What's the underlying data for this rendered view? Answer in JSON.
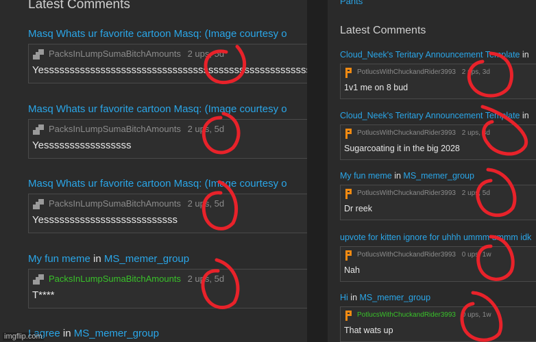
{
  "left": {
    "section_title": "Latest Comments",
    "entries": [
      {
        "post": "Masq Whats ur favorite cartoon Masq: (Image courtesy o",
        "in_word": "",
        "group": "",
        "user": "PacksInLumpSumaBitchAmounts",
        "user_green": false,
        "stats": "2 ups, 5d",
        "text": "Yessssssssssssssssssssssssssssssssssssssssssssssssssss"
      },
      {
        "post": "Masq Whats ur favorite cartoon Masq: (Image courtesy o",
        "in_word": "",
        "group": "",
        "user": "PacksInLumpSumaBitchAmounts",
        "user_green": false,
        "stats": "2 ups, 5d",
        "text": "Yesssssssssssssssss"
      },
      {
        "post": "Masq Whats ur favorite cartoon Masq: (Image courtesy o",
        "in_word": "",
        "group": "",
        "user": "PacksInLumpSumaBitchAmounts",
        "user_green": false,
        "stats": "2 ups, 5d",
        "text": "Yessssssssssssssssssssssssss"
      },
      {
        "post": "My fun meme",
        "in_word": "in",
        "group": "MS_memer_group",
        "user": "PacksInLumpSumaBitchAmounts",
        "user_green": true,
        "stats": "2 ups, 5d",
        "text": "T****"
      },
      {
        "post": "I agree",
        "in_word": "in",
        "group": "MS_memer_group"
      }
    ]
  },
  "right": {
    "top_link": "Pants",
    "section_title": "Latest Comments",
    "entries": [
      {
        "post": "Cloud_Neek's Teritary Announcement Template",
        "in_word": "in",
        "group": "",
        "user": "PotlucsWithChuckandRider3993",
        "user_green": false,
        "stats": "2 ups, 3d",
        "text": "1v1 me on 8 bud"
      },
      {
        "post": "Cloud_Neek's Teritary Announcement Template",
        "in_word": "in",
        "group": "",
        "user": "PotlucsWithChuckandRider3993",
        "user_green": false,
        "stats": "2 ups, 3d",
        "text": "Sugarcoating it in the big 2028"
      },
      {
        "post": "My fun meme",
        "in_word": "in",
        "group": "MS_memer_group",
        "user": "PotlucsWithChuckandRider3993",
        "user_green": false,
        "stats": "2 ups, 5d",
        "text": "Dr reek"
      },
      {
        "post": "upvote for kitten ignore for uhhh ummm ummm idk",
        "in_word": "",
        "group": "",
        "user": "PotlucsWithChuckandRider3993",
        "user_green": false,
        "stats": "0 ups, 1w",
        "text": "Nah"
      },
      {
        "post": "Hi",
        "in_word": "in",
        "group": "MS_memer_group",
        "user": "PotlucsWithChuckandRider3993",
        "user_green": true,
        "stats": "0 ups, 1w",
        "text": "That wats up"
      }
    ]
  },
  "icons": {
    "left_avatar": "imgflip-user-icon",
    "right_avatar": "imgflip-p-user-icon"
  },
  "colors": {
    "link": "#2aa6e8",
    "annotation": "#e8222a",
    "username_online": "#39c22a"
  },
  "watermark": "imgflip.com"
}
